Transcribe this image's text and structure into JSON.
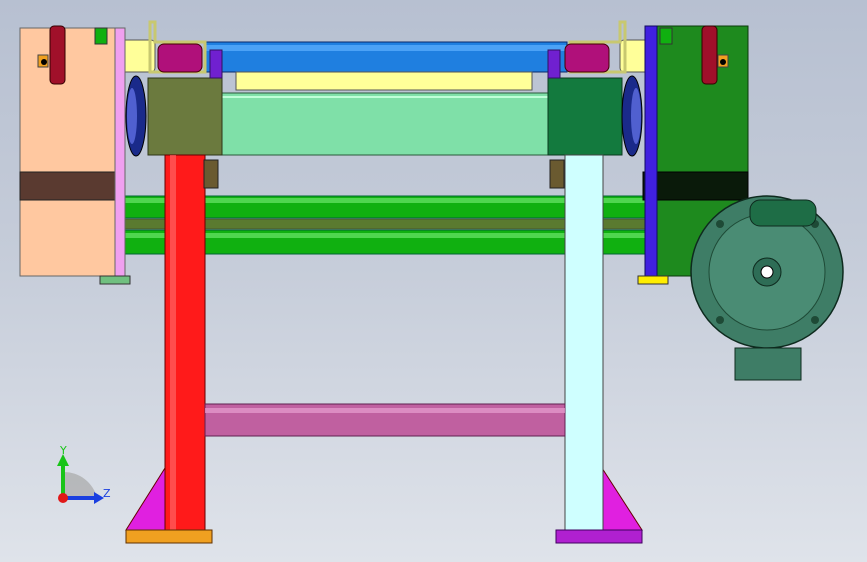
{
  "viewport": {
    "background_top": "#b7c0d1",
    "background_bottom": "#dfe3ea"
  },
  "triad": {
    "y_label": "Y",
    "z_label": "Z",
    "y_color": "#18c418",
    "z_color": "#1a3fe0",
    "origin_color": "#e01818"
  },
  "colors": {
    "left_leg": "#ff1a1a",
    "right_leg": "#cfffff",
    "cross_beam": "#c060a0",
    "top_blue_bar": "#1f7fe0",
    "center_block": "#7fe0a8",
    "green_rods": "#10b010",
    "left_housing": "#ffc8a0",
    "right_housing": "#1e8a1e",
    "motor": "#3e7d66",
    "gussets": "#e020e0",
    "left_foot": "#f0a020",
    "right_foot": "#b020d0"
  },
  "icons": [
    "coordinate-triad-icon",
    "motor-icon",
    "bearing-icon",
    "flange-icon"
  ]
}
